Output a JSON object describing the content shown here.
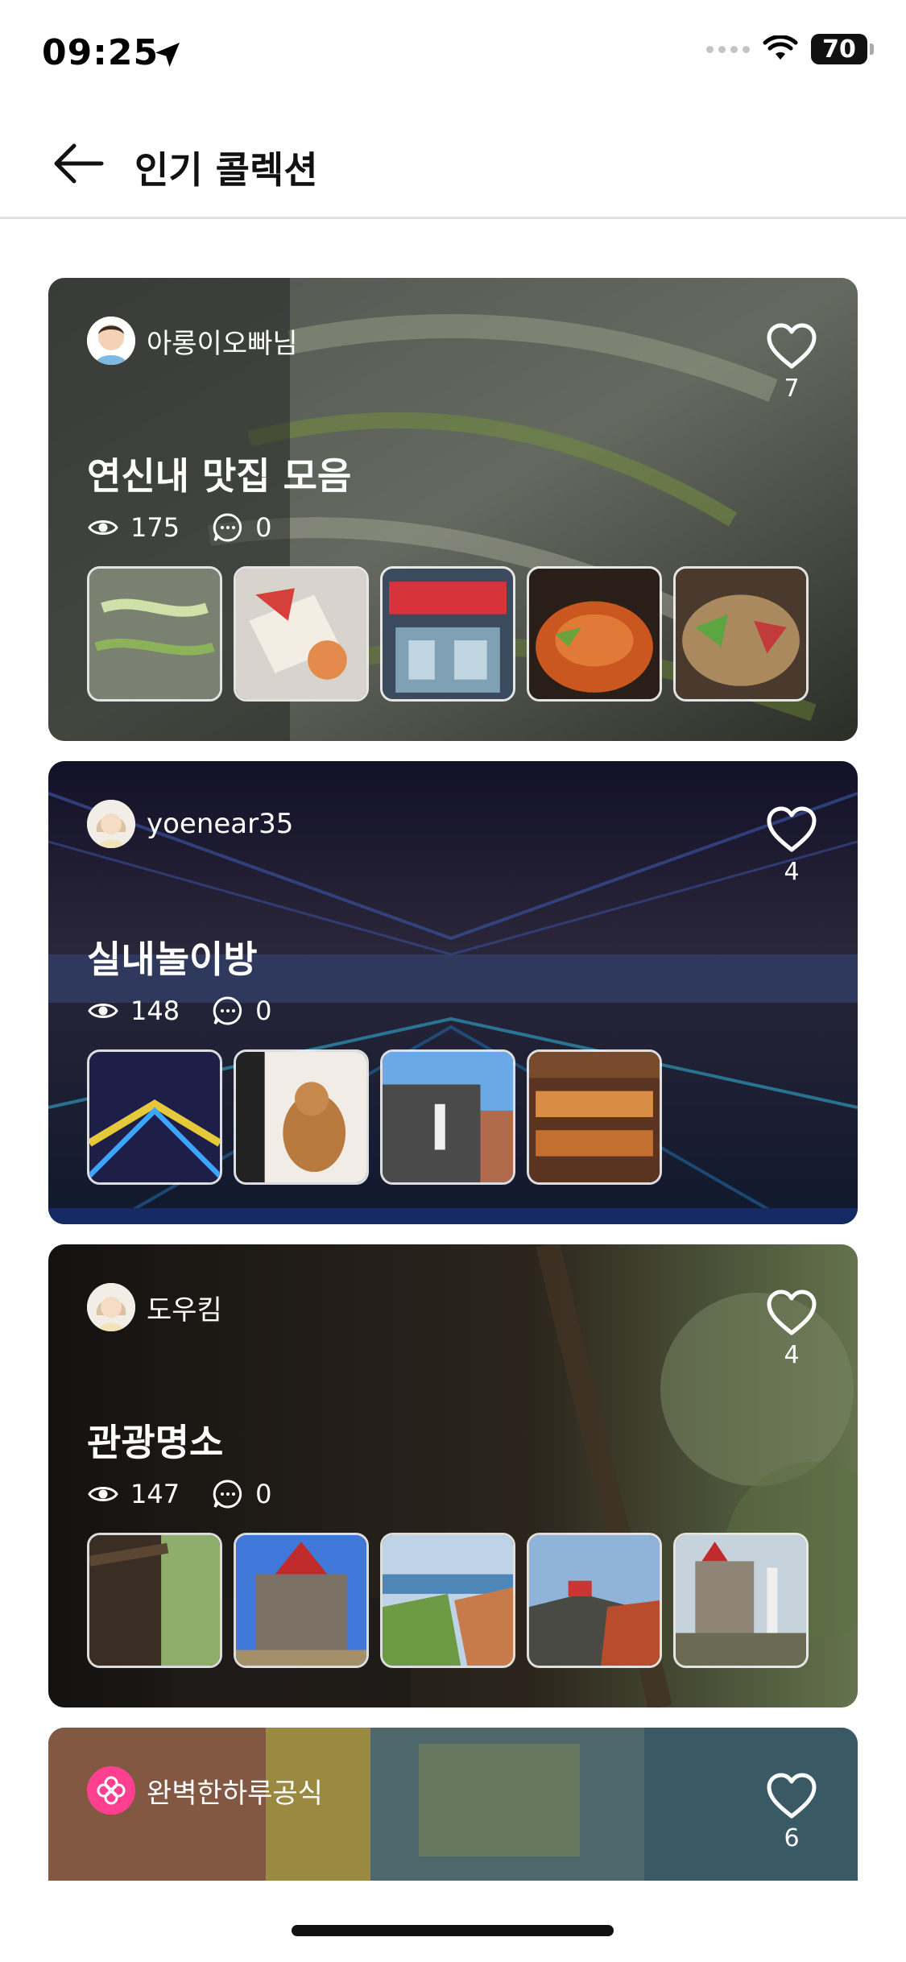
{
  "status": {
    "time": "09:25",
    "battery": "70"
  },
  "header": {
    "title": "인기 콜렉션"
  },
  "colors": {
    "like": "#ffffff",
    "header_divider": "#e1e1e1"
  },
  "collections": [
    {
      "user": "아롱이오빠님",
      "likes": "7",
      "title": "연신내 맛집 모음",
      "views": "175",
      "comments": "0",
      "thumbnail_count": 5
    },
    {
      "user": "yoenear35",
      "likes": "4",
      "title": "실내놀이방",
      "views": "148",
      "comments": "0",
      "thumbnail_count": 4
    },
    {
      "user": "도우킴",
      "likes": "4",
      "title": "관광명소",
      "views": "147",
      "comments": "0",
      "thumbnail_count": 5
    },
    {
      "user": "완벽한하루공식",
      "likes": "6"
    }
  ]
}
